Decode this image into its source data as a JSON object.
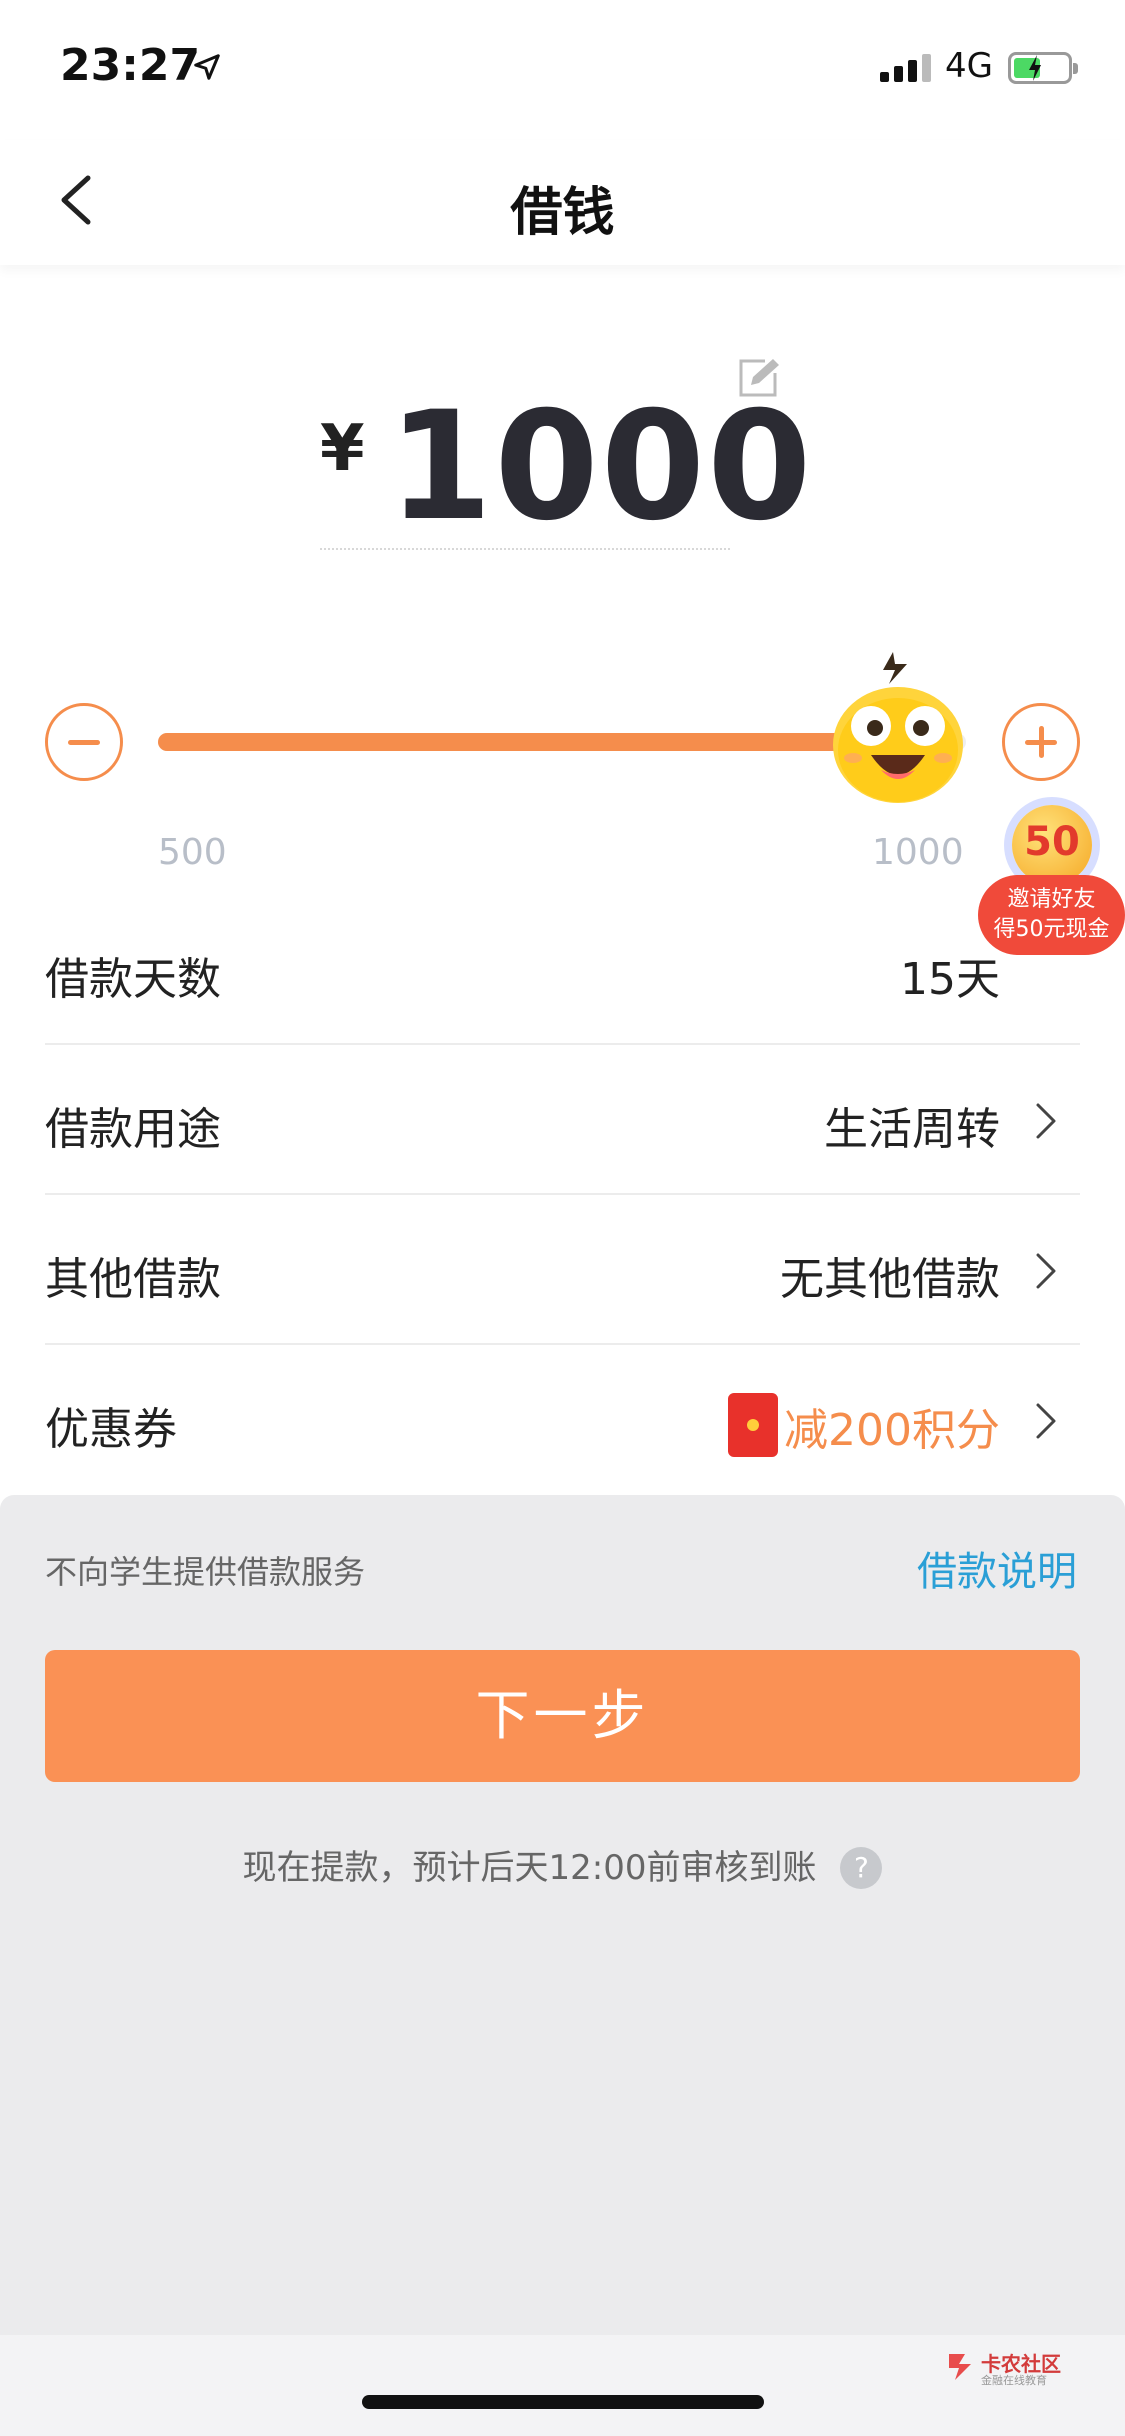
{
  "status_bar": {
    "time": "23:27",
    "network": "4G",
    "location_icon": "location-arrow-icon",
    "signal_icon": "signal-icon",
    "battery_icon": "battery-charging-icon",
    "battery_color": "#4cd964"
  },
  "nav": {
    "title": "借钱",
    "back_icon": "chevron-left-icon"
  },
  "amount": {
    "currency": "¥",
    "value": "1000",
    "edit_icon": "edit-icon"
  },
  "slider": {
    "min_label": "500",
    "max_label": "1000",
    "level_fraction": 1.0,
    "minus_icon": "minus-circle-icon",
    "plus_icon": "plus-circle-icon",
    "thumb_icon": "mascot-face-icon",
    "accent_color": "#f58d4c"
  },
  "invite": {
    "coin_text": "50",
    "line1": "邀请好友",
    "line2": "得50元现金",
    "pill_color": "#f04a3a"
  },
  "rows": [
    {
      "label": "借款天数",
      "value": "15天",
      "has_chevron": false
    },
    {
      "label": "借款用途",
      "value": "生活周转",
      "has_chevron": true
    },
    {
      "label": "其他借款",
      "value": "无其他借款",
      "has_chevron": true
    },
    {
      "label": "优惠券",
      "value": "减200积分",
      "has_chevron": true,
      "icon": "red-packet-icon"
    }
  ],
  "panel": {
    "notice": "不向学生提供借款服务",
    "explain_link": "借款说明",
    "next_button": "下一步",
    "tip": "现在提款，预计后天12:00前审核到账",
    "help_icon": "question-circle-icon",
    "help_text": "?",
    "link_color": "#2a9fd6",
    "button_color": "#fa9155"
  },
  "watermark": {
    "title": "卡农社区",
    "subtitle": "金融在线教育"
  }
}
